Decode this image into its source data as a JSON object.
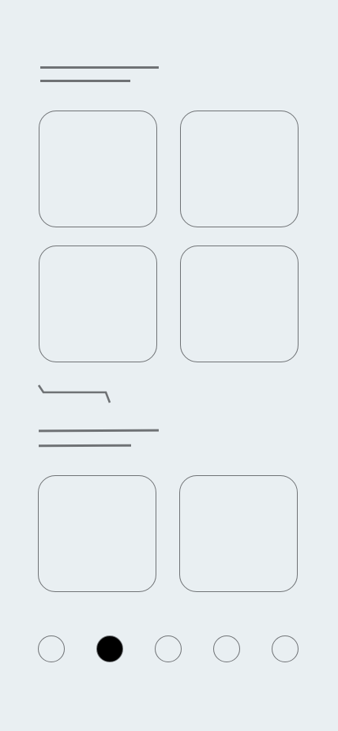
{
  "sections": [
    {
      "name": "section-1",
      "tiles": 4
    },
    {
      "name": "section-2",
      "tiles": 2
    }
  ],
  "pager": {
    "count": 5,
    "active_index": 1
  },
  "colors": {
    "background": "#e9eff2",
    "stroke": "#6f7275",
    "active_dot": "#000000"
  }
}
